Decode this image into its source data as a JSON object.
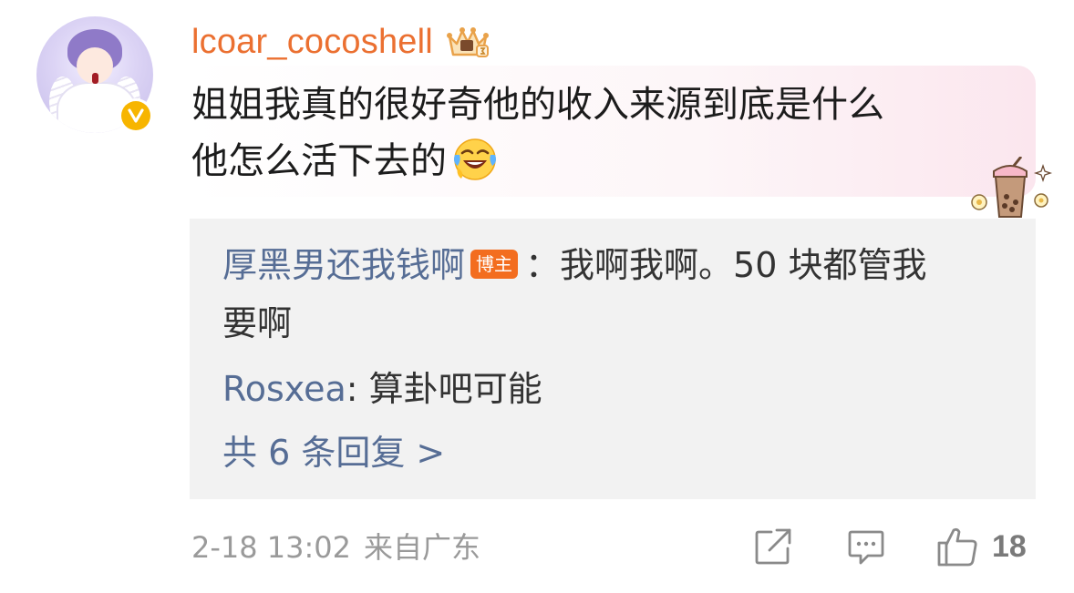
{
  "comment": {
    "username": "lcoar_cocoshell",
    "lines": [
      "姐姐我真的很好奇他的收入来源到底是什么",
      "他怎么活下去的"
    ],
    "avatar_icon": "anime-angel-avatar",
    "verified_icon": "verified-v-badge",
    "crown_icon": "membership-crown-icon",
    "emoji": "laughing-tears-emoji",
    "decoration": "bubble-tea-decoration"
  },
  "replies": {
    "items": [
      {
        "name": "厚黑男还我钱啊",
        "badge": "博主",
        "separator": "：",
        "text_line1": "我啊我啊。50 块都管我",
        "text_line2": "要啊"
      },
      {
        "name": "Rosxea",
        "separator": ": ",
        "text_line1": "算卦吧可能"
      }
    ],
    "more_label": "共 6 条回复 >"
  },
  "footer": {
    "time": "2-18 13:02",
    "location": "来自广东",
    "like_count": "18",
    "share_icon": "share-icon",
    "comment_icon": "comment-icon",
    "like_icon": "thumbs-up-icon"
  },
  "colors": {
    "username": "#eb7031",
    "link_blue": "#566d95",
    "badge_orange": "#f36d1f",
    "reply_bg": "#f2f2f2",
    "meta_gray": "#9a9a9a"
  }
}
